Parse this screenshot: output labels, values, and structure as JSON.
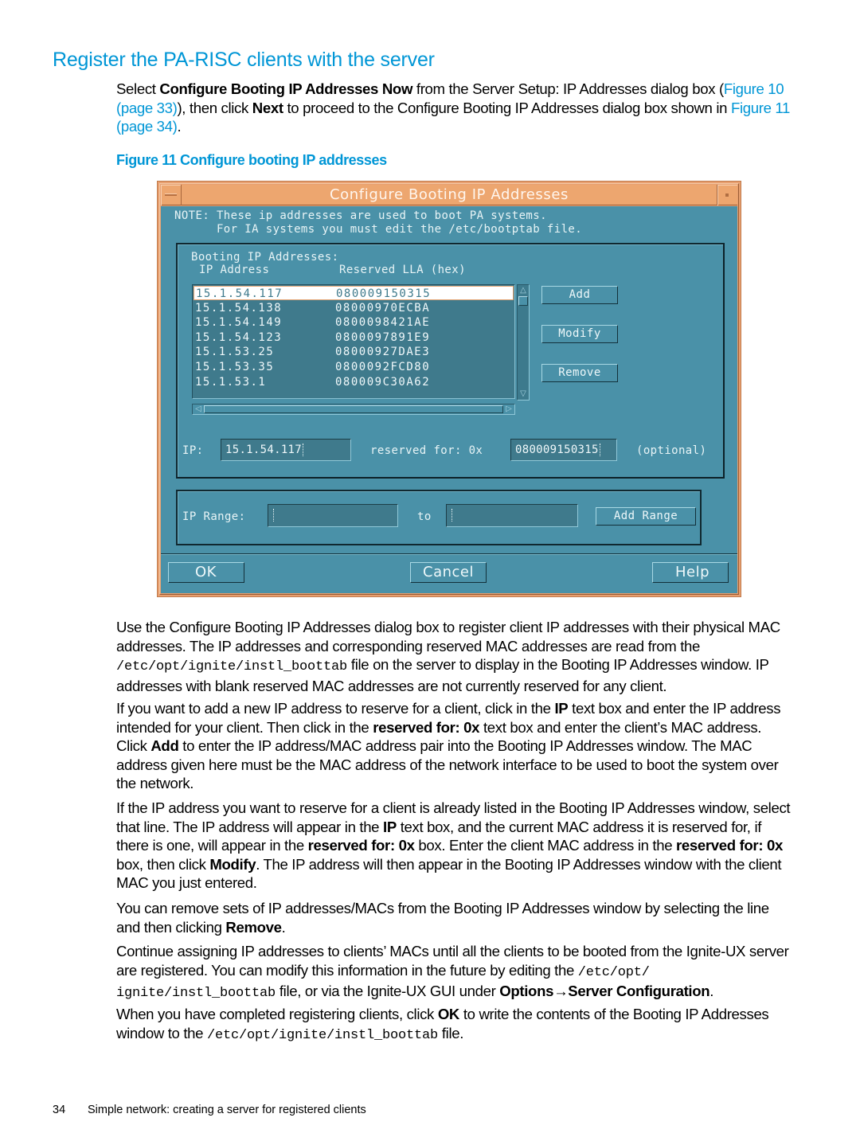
{
  "heading": "Register the PA-RISC clients with the server",
  "intro": {
    "t1": "Select ",
    "b1": "Configure Booting IP Addresses Now",
    "t2": " from the Server Setup: IP Addresses dialog box (",
    "link1": "Figure 10 (page 33)",
    "t3": "), then click ",
    "b2": "Next",
    "t4": " to proceed to the Configure Booting IP Addresses dialog box shown in ",
    "link2": "Figure 11 (page 34)",
    "t5": "."
  },
  "figure_caption": "Figure 11 Configure booting IP addresses",
  "dialog": {
    "title": "Configure Booting IP Addresses",
    "note_line1": "NOTE: These ip addresses are used to boot PA systems.",
    "note_line2": "      For IA systems you must edit the /etc/bootptab file.",
    "list_label": "Booting IP Addresses:",
    "col_ip": "IP Address",
    "col_lla": "Reserved LLA (hex)",
    "rows": [
      {
        "ip": "15.1.54.117",
        "lla": "080009150315",
        "selected": true
      },
      {
        "ip": "15.1.54.138",
        "lla": "08000970ECBA",
        "selected": false
      },
      {
        "ip": "15.1.54.149",
        "lla": "0800098421AE",
        "selected": false
      },
      {
        "ip": "15.1.54.123",
        "lla": "0800097891E9",
        "selected": false
      },
      {
        "ip": "15.1.53.25",
        "lla": "08000927DAE3",
        "selected": false
      },
      {
        "ip": "15.1.53.35",
        "lla": "0800092FCD80",
        "selected": false
      },
      {
        "ip": "15.1.53.1",
        "lla": "080009C30A62",
        "selected": false
      }
    ],
    "add_label": "Add",
    "modify_label": "Modify",
    "remove_label": "Remove",
    "ip_label": "IP:",
    "ip_value": "15.1.54.117",
    "reserved_label": "reserved for: 0x",
    "reserved_value": "080009150315",
    "optional_label": "(optional)",
    "range_label": "IP Range:",
    "range_from_value": "",
    "range_to_label": "to",
    "range_to_value": "",
    "add_range_label": "Add Range",
    "ok_label": "OK",
    "cancel_label": "Cancel",
    "help_label": "Help"
  },
  "p1": {
    "t1": "Use the Configure Booting IP Addresses dialog box to register client IP addresses with their physical MAC addresses. The IP addresses and corresponding reserved MAC addresses are read from the ",
    "code1": "/etc/opt/ignite/instl_boottab",
    "t2": " file on the server to display in the Booting IP Addresses window. IP addresses with blank reserved MAC addresses are not currently reserved for any client."
  },
  "p2": {
    "t1": "If you want to add a new IP address to reserve for a client, click in the ",
    "b1": "IP",
    "t2": " text box and enter the IP address intended for your client. Then click in the ",
    "b2": "reserved for: 0x",
    "t3": " text box and enter the client’s MAC address. Click ",
    "b3": "Add",
    "t4": " to enter the IP address/MAC address pair into the Booting IP Addresses window. The MAC address given here must be the MAC address of the network interface to be used to boot the system over the network."
  },
  "p3": {
    "t1": "If the IP address you want to reserve for a client is already listed in the Booting IP Addresses window, select that line. The IP address will appear in the ",
    "b1": "IP",
    "t2": " text box, and the current MAC address it is reserved for, if there is one, will appear in the ",
    "b2": "reserved for: 0x",
    "t3": " box. Enter the client MAC address in the ",
    "b3": "reserved for: 0x",
    "t4": " box, then click ",
    "b4": "Modify",
    "t5": ". The IP address will then appear in the Booting IP Addresses window with the client MAC you just entered."
  },
  "p4": {
    "t1": "You can remove sets of IP addresses/MACs from the Booting IP Addresses window by selecting the line and then clicking ",
    "b1": "Remove",
    "t2": "."
  },
  "p5": {
    "t1": "Continue assigning IP addresses to clients’ MACs until all the clients to be booted from the Ignite-UX server are registered. You can modify this information in the future by editing the ",
    "code1": "/etc/opt/ ignite/instl_boottab",
    "t2": " file, or via the Ignite-UX GUI under ",
    "b1": "Options→Server Configuration",
    "t3": "."
  },
  "p6": {
    "t1": "When you have completed registering clients, click ",
    "b1": "OK",
    "t2": " to write the contents of the Booting IP Addresses window to the ",
    "code1": "/etc/opt/ignite/instl_boottab",
    "t3": " file."
  },
  "footer": {
    "page_number": "34",
    "section": "Simple network: creating a server for registered clients"
  }
}
